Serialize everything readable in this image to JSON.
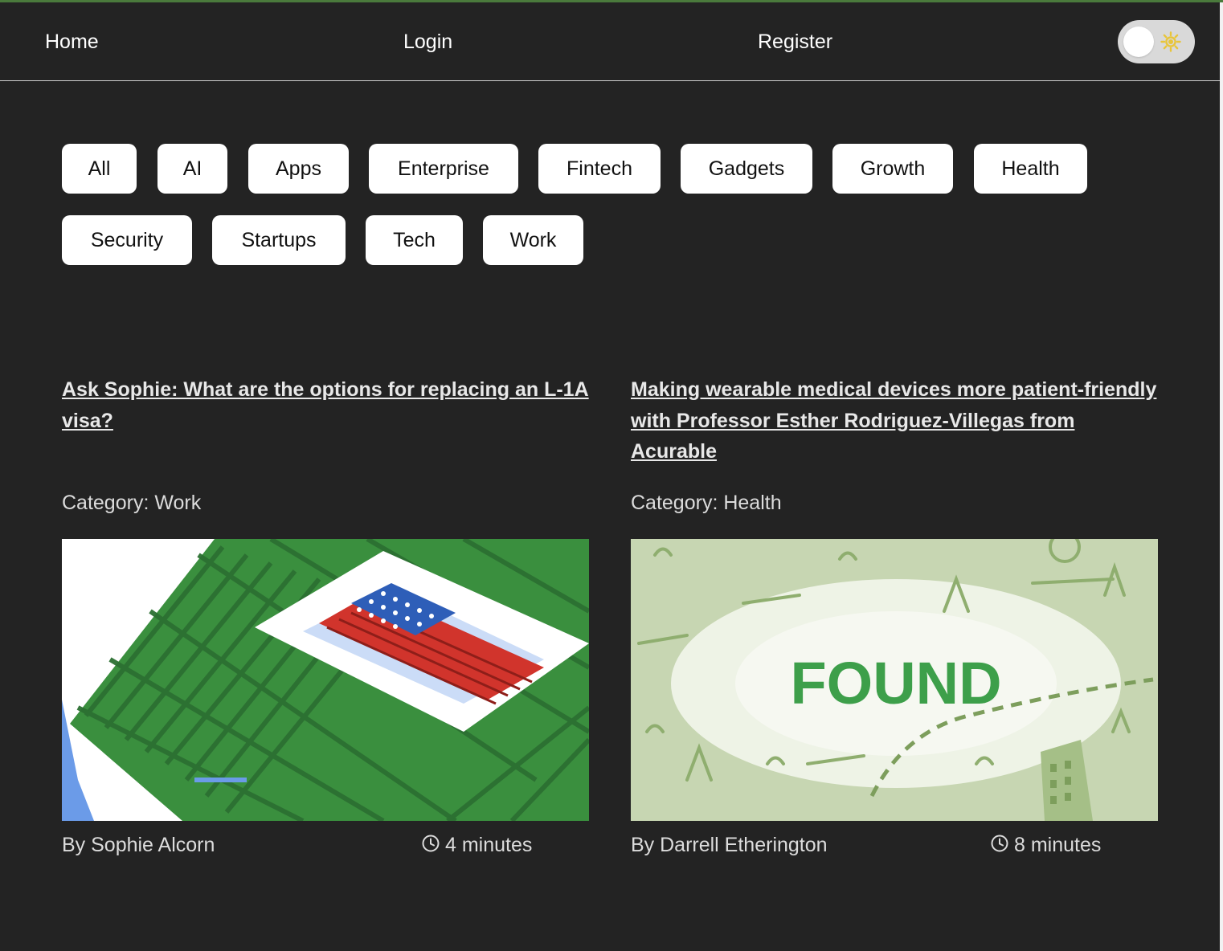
{
  "nav": {
    "home": "Home",
    "login": "Login",
    "register": "Register",
    "theme_toggle_icon": "sun-icon",
    "theme_toggle_state": "light-off"
  },
  "categories": [
    "All",
    "AI",
    "Apps",
    "Enterprise",
    "Fintech",
    "Gadgets",
    "Growth",
    "Health",
    "Security",
    "Startups",
    "Tech",
    "Work"
  ],
  "articles": [
    {
      "title": "Ask Sophie: What are the options for replacing an L-1A visa?",
      "category_label": "Category:",
      "category": "Work",
      "author": "By Sophie Alcorn",
      "read_time": "4 minutes",
      "image": "maze-with-american-flag-illustration"
    },
    {
      "title": "Making wearable medical devices more patient-friendly with Professor Esther Rodriguez-Villegas from Acurable",
      "category_label": "Category:",
      "category": "Health",
      "author": "By Darrell Etherington",
      "read_time": "8 minutes",
      "image": "found-podcast-logo",
      "image_text": "FOUND"
    }
  ],
  "colors": {
    "background": "#232323",
    "chip_bg": "#ffffff",
    "toggle_bg": "#d9d9d9",
    "sun": "#e8c53a",
    "found_green": "#3d9f4a"
  }
}
